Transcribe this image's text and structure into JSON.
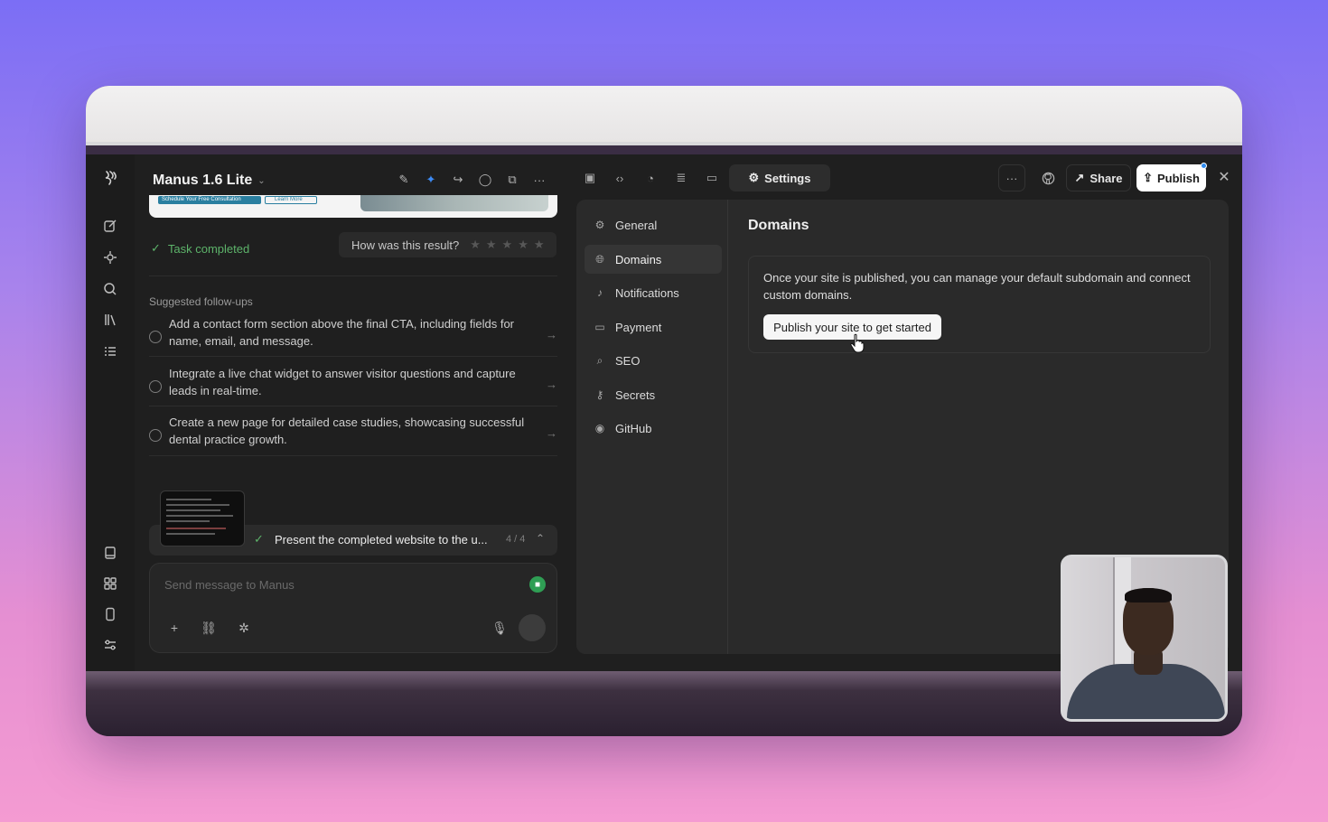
{
  "app": {
    "title": "Manus 1.6 Lite"
  },
  "chat": {
    "preview_buttons": [
      "Schedule Your Free Consultation",
      "Learn More"
    ],
    "task_status": "Task completed",
    "rating_prompt": "How was this result?",
    "followups_label": "Suggested follow-ups",
    "followups": [
      "Add a contact form section above the final CTA, including fields for name, email, and message.",
      "Integrate a live chat widget to answer visitor questions and capture leads in real-time.",
      "Create a new page for detailed case studies, showcasing successful dental practice growth."
    ],
    "step": {
      "label": "Present the completed website to the u...",
      "count": "4 / 4"
    },
    "composer_placeholder": "Send message to Manus"
  },
  "toolbar": {
    "settings_label": "Settings",
    "share_label": "Share",
    "publish_label": "Publish"
  },
  "settings": {
    "nav": [
      "General",
      "Domains",
      "Notifications",
      "Payment",
      "SEO",
      "Secrets",
      "GitHub"
    ],
    "active": "Domains",
    "title": "Domains",
    "description": "Once your site is published, you can manage your default subdomain and connect custom domains.",
    "cta": "Publish your site to get started"
  },
  "colors": {
    "background_top": "#7b6ef5",
    "background_bottom": "#f49bd2",
    "success": "#5db36a",
    "accent_dot": "#2f8cf0"
  }
}
